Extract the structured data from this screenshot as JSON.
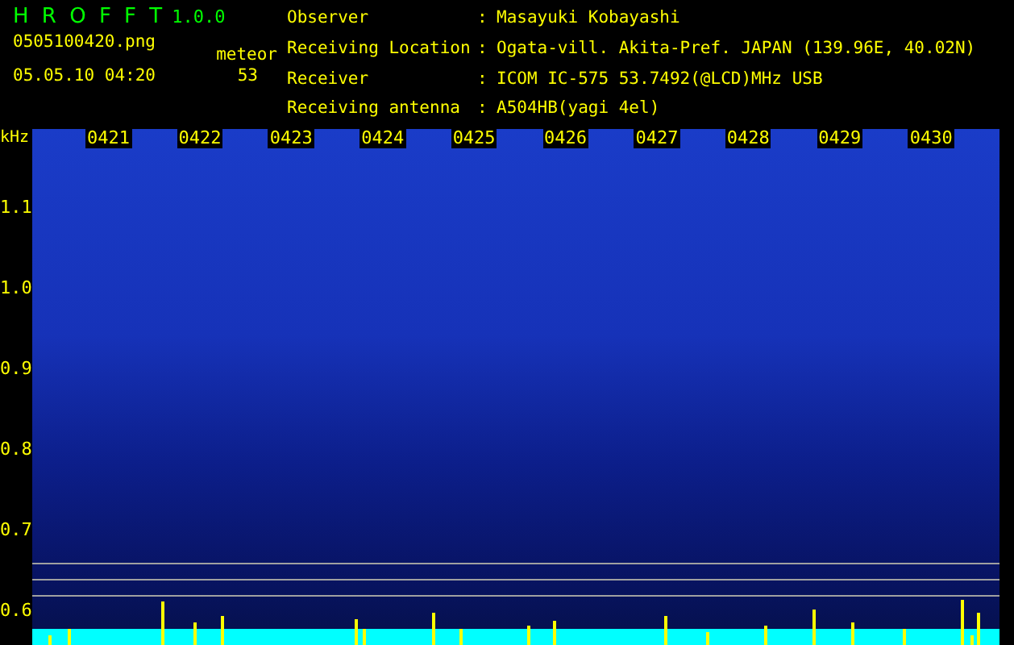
{
  "app": {
    "name": "H R O F F T",
    "version": "1.0.0",
    "file": "0505100420.png",
    "datetime": "05.05.10 04:20",
    "meteor_label": "meteor",
    "meteor_count": "53"
  },
  "info": [
    {
      "label": "Observer",
      "separator": ":",
      "value": "Masayuki Kobayashi"
    },
    {
      "label": "Receiving Location",
      "separator": ":",
      "value": "Ogata-vill. Akita-Pref. JAPAN (139.96E, 40.02N)"
    },
    {
      "label": "Receiver",
      "separator": ":",
      "value": "ICOM IC-575 53.7492(@LCD)MHz USB"
    },
    {
      "label": "Receiving antenna",
      "separator": ":",
      "value": "A504HB(yagi 4el)"
    }
  ],
  "spectrogram": {
    "unit": "kHz",
    "time_labels": [
      "0421",
      "0422",
      "0423",
      "0424",
      "0425",
      "0426",
      "0427",
      "0428",
      "0429",
      "0430"
    ],
    "frequency_labels": [
      "1.1",
      "1.0",
      "0.9",
      "0.8",
      "0.7",
      "0.6"
    ]
  }
}
